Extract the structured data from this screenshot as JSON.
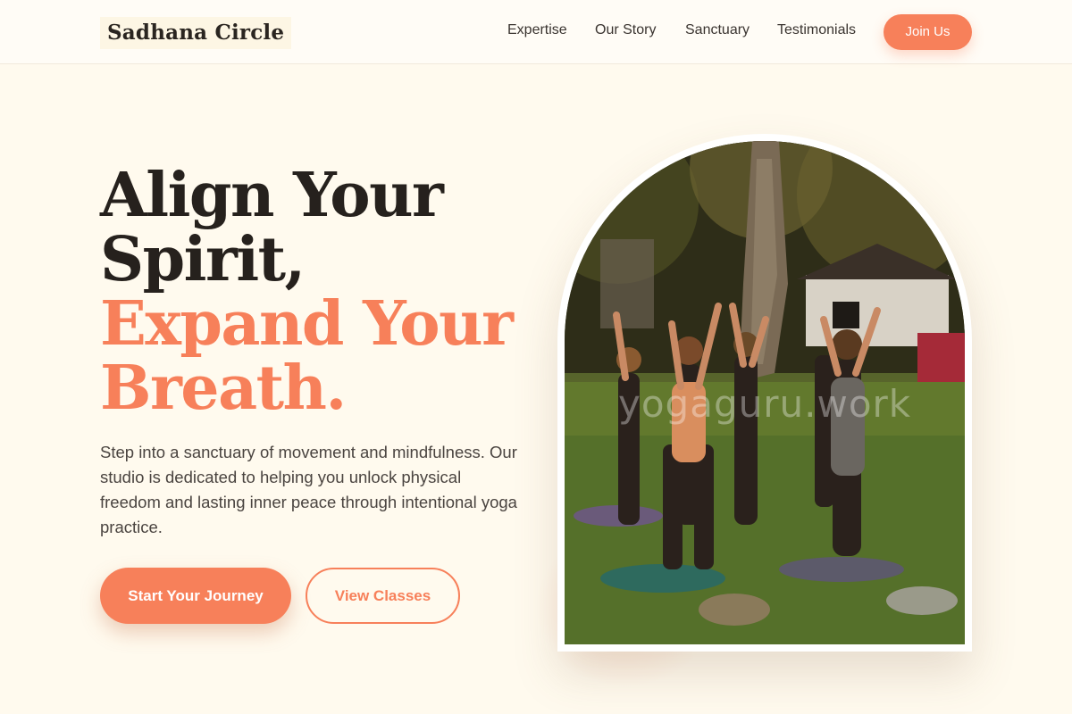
{
  "brand": {
    "name": "Sadhana Circle"
  },
  "nav": {
    "items": [
      {
        "label": "Expertise"
      },
      {
        "label": "Our Story"
      },
      {
        "label": "Sanctuary"
      },
      {
        "label": "Testimonials"
      }
    ],
    "cta": "Join Us"
  },
  "hero": {
    "headline_line1": "Align Your",
    "headline_line2": "Spirit,",
    "headline_line3": "Expand Your",
    "headline_line4": "Breath.",
    "lead": "Step into a sanctuary of movement and mindfulness. Our studio is dedicated to helping you unlock physical freedom and lasting inner peace through intentional yoga practice.",
    "primary_button": "Start Your Journey",
    "secondary_button": "View Classes"
  },
  "image": {
    "watermark": "yogaguru.work"
  },
  "colors": {
    "background": "#fffaee",
    "accent": "#f7805a",
    "text_dark": "#26211d"
  }
}
